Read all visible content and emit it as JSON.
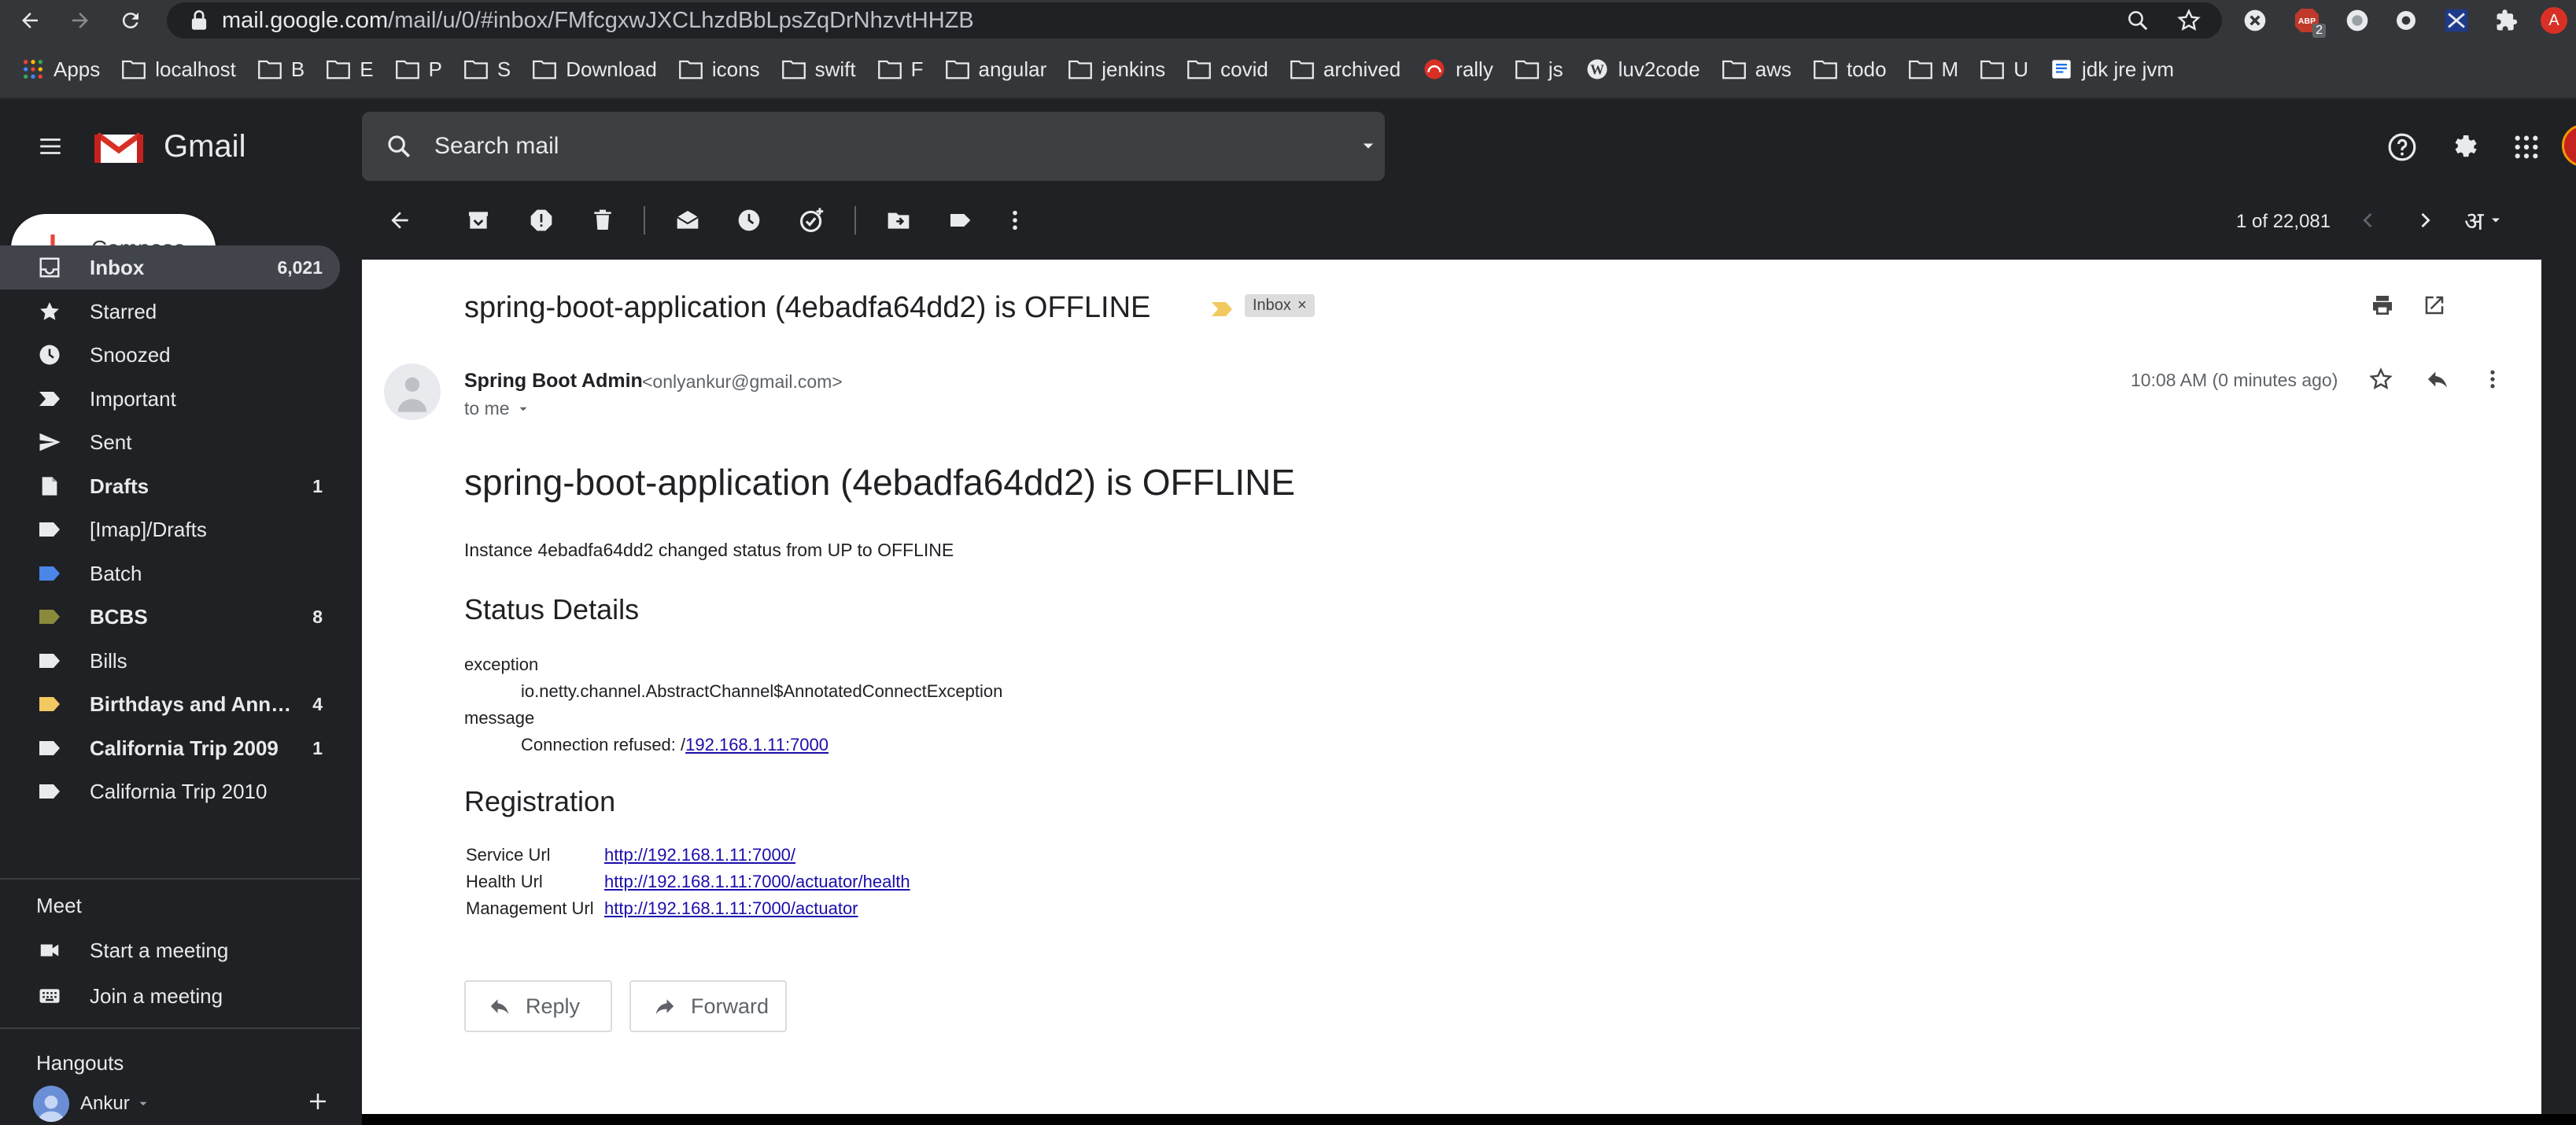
{
  "browser": {
    "url_host": "mail.google.com",
    "url_path": "/mail/u/0/#inbox/FMfcgxwJXCLhzdBbLpsZqDrNhzvtHHZB",
    "ext_badge": "2",
    "profile_initial": "A",
    "bookmarks": [
      {
        "label": "Apps",
        "icon": "apps-grid-icon"
      },
      {
        "label": "localhost",
        "icon": "folder-icon"
      },
      {
        "label": "B",
        "icon": "folder-icon"
      },
      {
        "label": "E",
        "icon": "folder-icon"
      },
      {
        "label": "P",
        "icon": "folder-icon"
      },
      {
        "label": "S",
        "icon": "folder-icon"
      },
      {
        "label": "Download",
        "icon": "folder-icon"
      },
      {
        "label": "icons",
        "icon": "folder-icon"
      },
      {
        "label": "swift",
        "icon": "folder-icon"
      },
      {
        "label": "F",
        "icon": "folder-icon"
      },
      {
        "label": "angular",
        "icon": "folder-icon"
      },
      {
        "label": "jenkins",
        "icon": "folder-icon"
      },
      {
        "label": "covid",
        "icon": "folder-icon"
      },
      {
        "label": "archived",
        "icon": "folder-icon"
      },
      {
        "label": "rally",
        "icon": "rally-icon"
      },
      {
        "label": "js",
        "icon": "folder-icon"
      },
      {
        "label": "luv2code",
        "icon": "wordpress-icon"
      },
      {
        "label": "aws",
        "icon": "folder-icon"
      },
      {
        "label": "todo",
        "icon": "folder-icon"
      },
      {
        "label": "M",
        "icon": "folder-icon"
      },
      {
        "label": "U",
        "icon": "folder-icon"
      },
      {
        "label": "jdk jre jvm",
        "icon": "page-icon"
      }
    ]
  },
  "gmail": {
    "brand": "Gmail",
    "search_placeholder": "Search mail",
    "compose_label": "Compose",
    "nav": [
      {
        "label": "Inbox",
        "count": "6,021",
        "bold": true,
        "selected": true,
        "icon": "inbox-icon"
      },
      {
        "label": "Starred",
        "count": "",
        "icon": "star-icon"
      },
      {
        "label": "Snoozed",
        "count": "",
        "icon": "clock-icon"
      },
      {
        "label": "Important",
        "count": "",
        "icon": "important-icon"
      },
      {
        "label": "Sent",
        "count": "",
        "icon": "send-icon"
      },
      {
        "label": "Drafts",
        "count": "1",
        "bold": true,
        "icon": "draft-icon"
      },
      {
        "label": "[Imap]/Drafts",
        "count": "",
        "icon": "label-icon",
        "color": "#e8eaed"
      },
      {
        "label": "Batch",
        "count": "",
        "icon": "label-icon",
        "color": "#4a86e8"
      },
      {
        "label": "BCBS",
        "count": "8",
        "bold": true,
        "icon": "label-icon",
        "color": "#8a8a3c"
      },
      {
        "label": "Bills",
        "count": "",
        "icon": "label-icon",
        "color": "#e8eaed"
      },
      {
        "label": "Birthdays and Anniv...",
        "count": "4",
        "bold": true,
        "icon": "label-icon",
        "color": "#f2c960"
      },
      {
        "label": "California Trip 2009",
        "count": "1",
        "bold": true,
        "icon": "label-icon",
        "color": "#e8eaed"
      },
      {
        "label": "California Trip 2010",
        "count": "",
        "icon": "label-icon",
        "color": "#e8eaed"
      }
    ],
    "meet_heading": "Meet",
    "meet_items": [
      {
        "label": "Start a meeting",
        "icon": "video-icon"
      },
      {
        "label": "Join a meeting",
        "icon": "keyboard-icon"
      }
    ],
    "hangouts_heading": "Hangouts",
    "hangouts_user": "Ankur",
    "pagination": "1 of 22,081",
    "input_tool": "अ"
  },
  "message": {
    "subject": "spring-boot-application (4ebadfa64dd2) is OFFLINE",
    "label_badge": "Inbox",
    "from_name": "Spring Boot Admin",
    "from_email": "<onlyankur@gmail.com>",
    "to_line": "to me",
    "time": "10:08 AM (0 minutes ago)",
    "body_title": "spring-boot-application (4ebadfa64dd2) is OFFLINE",
    "status_line": "Instance 4ebadfa64dd2 changed status from UP to OFFLINE",
    "status_heading": "Status Details",
    "exception_key": "exception",
    "exception_value": "io.netty.channel.AbstractChannel$AnnotatedConnectException",
    "message_key": "message",
    "message_prefix": "Connection refused: /",
    "message_link": "192.168.1.11:7000",
    "registration_heading": "Registration",
    "registration": [
      {
        "key": "Service Url",
        "value": "http://192.168.1.11:7000/"
      },
      {
        "key": "Health Url",
        "value": "http://192.168.1.11:7000/actuator/health"
      },
      {
        "key": "Management Url",
        "value": "http://192.168.1.11:7000/actuator"
      }
    ],
    "reply_label": "Reply",
    "forward_label": "Forward"
  }
}
